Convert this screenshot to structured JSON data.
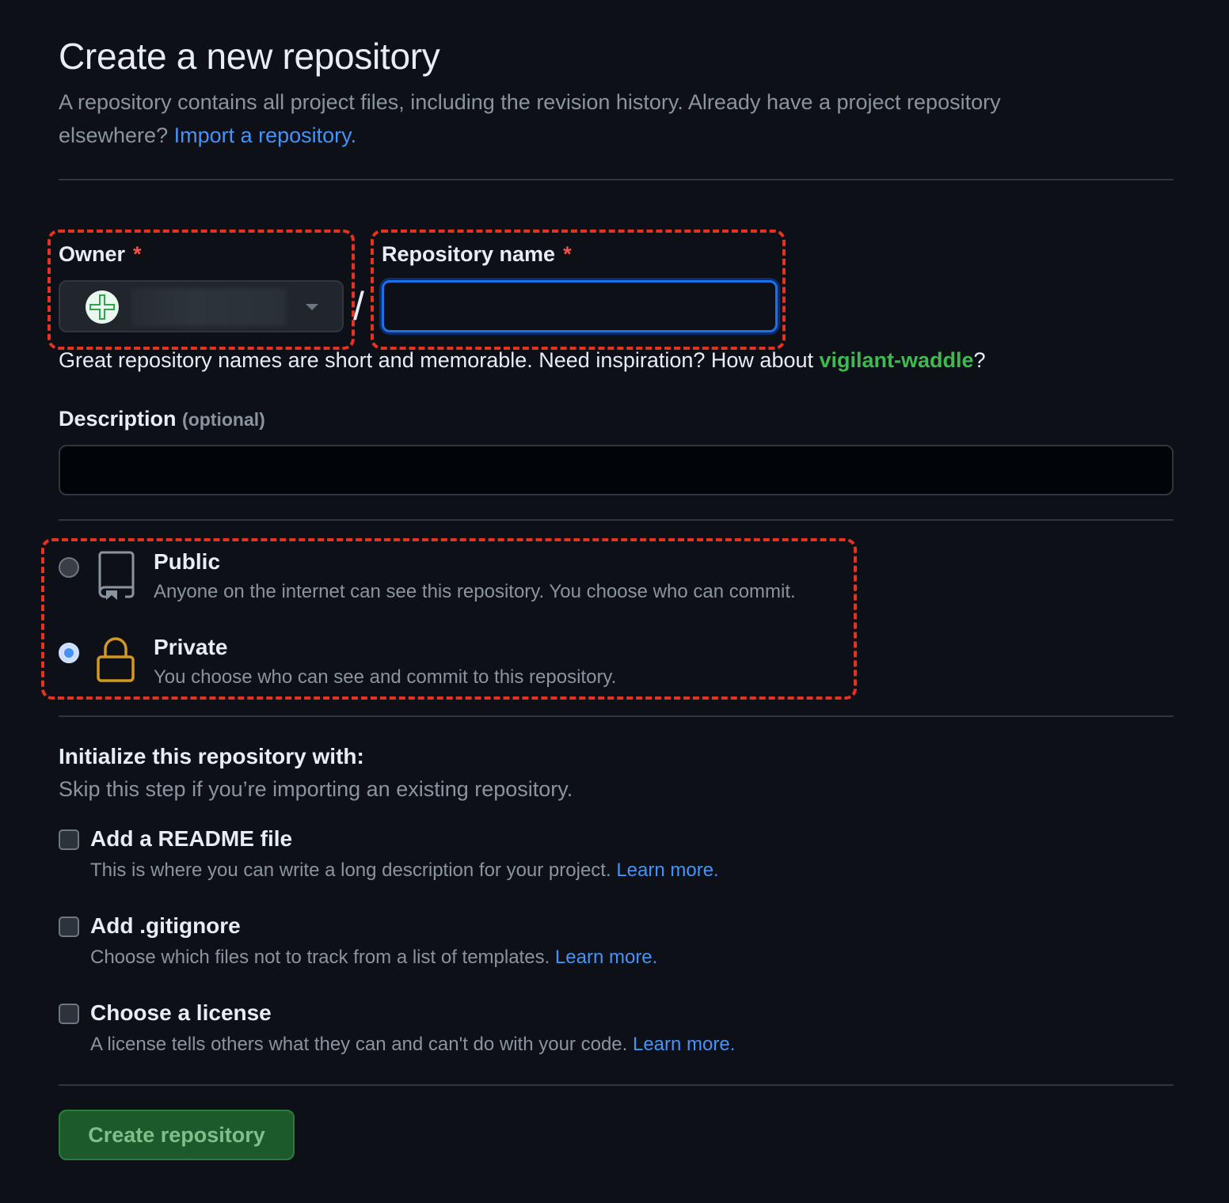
{
  "header": {
    "title": "Create a new repository",
    "subtitle_text": "A repository contains all project files, including the revision history. Already have a project repository elsewhere? ",
    "import_link": "Import a repository."
  },
  "owner": {
    "label": "Owner",
    "required_mark": "*",
    "icon": "avatar-icon"
  },
  "separator": "/",
  "repo_name": {
    "label": "Repository name",
    "required_mark": "*",
    "value": "",
    "hint_text": "Great repository names are short and memorable. Need inspiration? How about ",
    "suggestion": "vigilant-waddle",
    "hint_end": "?"
  },
  "description": {
    "label": "Description",
    "optional": "(optional)",
    "value": ""
  },
  "visibility": {
    "options": [
      {
        "title": "Public",
        "desc": "Anyone on the internet can see this repository. You choose who can commit.",
        "icon": "repo-icon",
        "selected": false
      },
      {
        "title": "Private",
        "desc": "You choose who can see and commit to this repository.",
        "icon": "lock-icon",
        "selected": true
      }
    ]
  },
  "initialize": {
    "title": "Initialize this repository with:",
    "subtitle": "Skip this step if you’re importing an existing repository.",
    "options": [
      {
        "title": "Add a README file",
        "desc": "This is where you can write a long description for your project. ",
        "link": "Learn more.",
        "checked": false
      },
      {
        "title": "Add .gitignore",
        "desc": "Choose which files not to track from a list of templates. ",
        "link": "Learn more.",
        "checked": false
      },
      {
        "title": "Choose a license",
        "desc": "A license tells others what they can and can't do with your code. ",
        "link": "Learn more.",
        "checked": false
      }
    ]
  },
  "submit": {
    "label": "Create repository"
  },
  "colors": {
    "background": "#0d1117",
    "accent_link": "#4493f8",
    "suggestion": "#3fb950",
    "annotation_dash": "#e5331f",
    "lock_icon": "#d29922",
    "button_bg": "#1c5a2c"
  }
}
